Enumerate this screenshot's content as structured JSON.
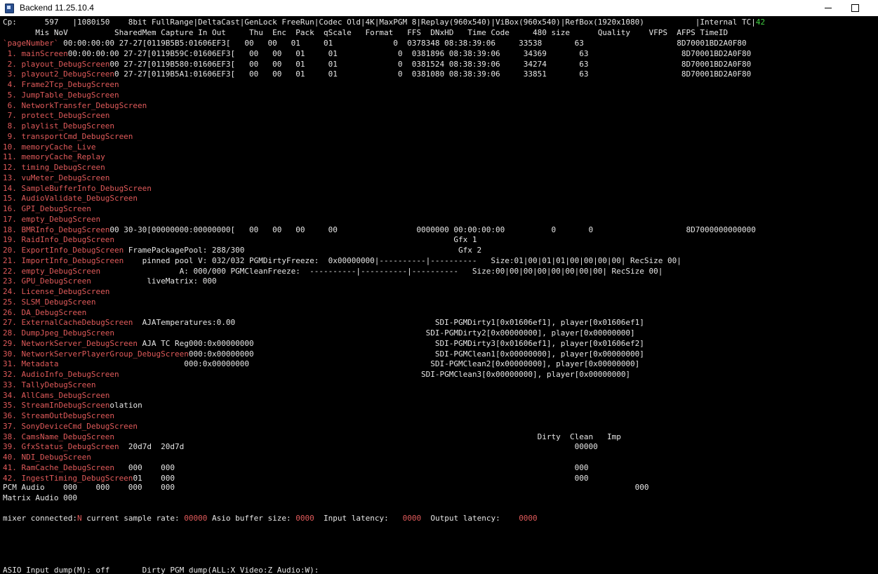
{
  "window": {
    "title": "Backend 11.25.10.4",
    "icons": {
      "app": "app-window-icon",
      "minimize": "minimize-icon",
      "maximize": "maximize-icon"
    }
  },
  "status_bar": {
    "text": "Cp:      597   |1080i50    8bit FullRange|DeltaCast|GenLock FreeRun|Codec Old|4K|MaxPGM 8|Replay(960x540)|ViBox(960x540)|RefBox(1920x1080)           |Internal TC|",
    "tc_value": "42"
  },
  "header": {
    "text": "       Mis NoV          SharedMem Capture In Out     Thu  Enc  Pack  qScale   Format   FFS  DNxHD   Time Code     480 size      Quality    VFPS  AFPS TimeID"
  },
  "screens": [
    {
      "label": "`pageNumber`",
      "rest": " 00:00:00:00 27-27[0119B5B5:01606EF3[   00   00   01     01             0  0378348 08:38:39:06     33538       63                    8D70001BD2A0F80"
    },
    {
      "label": " 1. mainScreen",
      "rest": "00:00:00:00 27-27[0119B59C:01606EF3[   00   00   01     01             0  0381896 08:38:39:06     34369       63                    8D70001BD2A0F80"
    },
    {
      "label": " 2. playout_DebugScreen",
      "rest": "00 27-27[0119B580:01606EF3[   00   00   01     01             0  0381524 08:38:39:06     34274       63                    8D70001BD2A0F80"
    },
    {
      "label": " 3. playout2_DebugScreen",
      "rest": "0 27-27[0119B5A1:01606EF3[   00   00   01     01             0  0381080 08:38:39:06     33851       63                    8D70001BD2A0F80"
    },
    {
      "label": " 4. Frame2Tcp_DebugScreen",
      "rest": ""
    },
    {
      "label": " 5. JumpTable_DebugScreen",
      "rest": ""
    },
    {
      "label": " 6. NetworkTransfer_DebugScreen",
      "rest": ""
    },
    {
      "label": " 7. protect_DebugScreen",
      "rest": ""
    },
    {
      "label": " 8. playlist_DebugScreen",
      "rest": ""
    },
    {
      "label": " 9. transportCmd_DebugScreen",
      "rest": ""
    },
    {
      "label": "10. memoryCache_Live",
      "rest": ""
    },
    {
      "label": "11. memoryCache_Replay",
      "rest": ""
    },
    {
      "label": "12. timing_DebugScreen",
      "rest": ""
    },
    {
      "label": "13. vuMeter_DebugScreen",
      "rest": ""
    },
    {
      "label": "14. SampleBufferInfo_DebugScreen",
      "rest": ""
    },
    {
      "label": "15. AudioValidate_DebugScreen",
      "rest": ""
    },
    {
      "label": "16. GPI_DebugScreen",
      "rest": ""
    },
    {
      "label": "17. empty_DebugScreen",
      "rest": ""
    },
    {
      "label": "18. BMRInfo_DebugScreen",
      "rest": "00 30-30[00000000:00000000[   00   00   00     00                 0000000 00:00:00:00          0       0                    8D7000000000000"
    },
    {
      "label": "19. RaidInfo_DebugScreen",
      "rest": "                                                                         Gfx 1"
    },
    {
      "label": "20. ExportInfo_DebugScreen",
      "rest": " FramePackagePool: 288/300                                              Gfx 2"
    },
    {
      "label": "21. ImportInfo_DebugScreen",
      "rest": "    pinned pool V: 032/032 PGMDirtyFreeze:  0x00000000|----------|----------   Size:01|00|01|01|00|00|00|00| RecSize 00|"
    },
    {
      "label": "22. empty_DebugScreen",
      "rest": "                 A: 000/000 PGMCleanFreeze:  ----------|----------|----------   Size:00|00|00|00|00|00|00|00| RecSize 00|"
    },
    {
      "label": "23. GPU_DebugScreen",
      "rest": "            liveMatrix: 000"
    },
    {
      "label": "24. License_DebugScreen",
      "rest": ""
    },
    {
      "label": "25. SLSM_DebugScreen",
      "rest": ""
    },
    {
      "label": "26. DA_DebugScreen",
      "rest": ""
    },
    {
      "label": "27. ExternalCacheDebugScreen",
      "rest": "  AJATemperatures:0.00                                           SDI-PGMDirty1[0x01606ef1], player[0x01606ef1]"
    },
    {
      "label": "28. DumpJpeg_DebugScreen",
      "rest": "                                                                   SDI-PGMDirty2[0x00000000], player[0x00000000]"
    },
    {
      "label": "29. NetworkServer_DebugScreen",
      "rest": " AJA TC Reg000:0x00000000                                       SDI-PGMDirty3[0x01606ef1], player[0x01606ef2]"
    },
    {
      "label": "30. NetworkServerPlayerGroup_DebugScreen",
      "rest": "000:0x00000000                                       SDI-PGMClean1[0x00000000], player[0x00000000]"
    },
    {
      "label": "31. Metadata",
      "rest": "                           000:0x00000000                                       SDI-PGMClean2[0x00000000], player[0x00000000]"
    },
    {
      "label": "32. AudioInfo_DebugScreen",
      "rest": "                                                                 SDI-PGMClean3[0x00000000], player[0x00000000]"
    },
    {
      "label": "33. TallyDebugScreen",
      "rest": ""
    },
    {
      "label": "34. AllCams_DebugScreen",
      "rest": ""
    },
    {
      "label": "35. StreamInDebugScreen",
      "rest": "olation"
    },
    {
      "label": "36. StreamOutDebugScreen",
      "rest": ""
    },
    {
      "label": "37. SonyDeviceCmd_DebugScreen",
      "rest": ""
    },
    {
      "label": "38. CamsName_DebugScreen",
      "rest": "                                                                                           Dirty  Clean   Imp"
    },
    {
      "label": "39. GfxStatus_DebugScreen",
      "rest": "  20d7d  20d7d                                                                                    00000"
    },
    {
      "label": "40. NDI_DebugScreen",
      "rest": ""
    },
    {
      "label": "41. RamCache_DebugScreen",
      "rest": "   000    000                                                                                      000"
    },
    {
      "label": "42. IngestTiming_DebugScreen",
      "rest": "01    000                                                                                      000"
    }
  ],
  "audio": {
    "pcm": "PCM Audio    000    000    000    000                                                                                                   000",
    "matrix": "Matrix Audio 000"
  },
  "mixer": {
    "label_connected": "mixer connected:",
    "connected": "N",
    "label_rate": " current sample rate: ",
    "rate": "00000",
    "label_buffer": " Asio buffer size: ",
    "buffer": "0000",
    "label_in": "  Input latency:   ",
    "in_latency": "0000",
    "label_out": "  Output latency:    ",
    "out_latency": "0000"
  },
  "footer": {
    "text": "ASIO Input dump(M): off       Dirty PGM dump(ALL:X Video:Z Audio:W):"
  }
}
